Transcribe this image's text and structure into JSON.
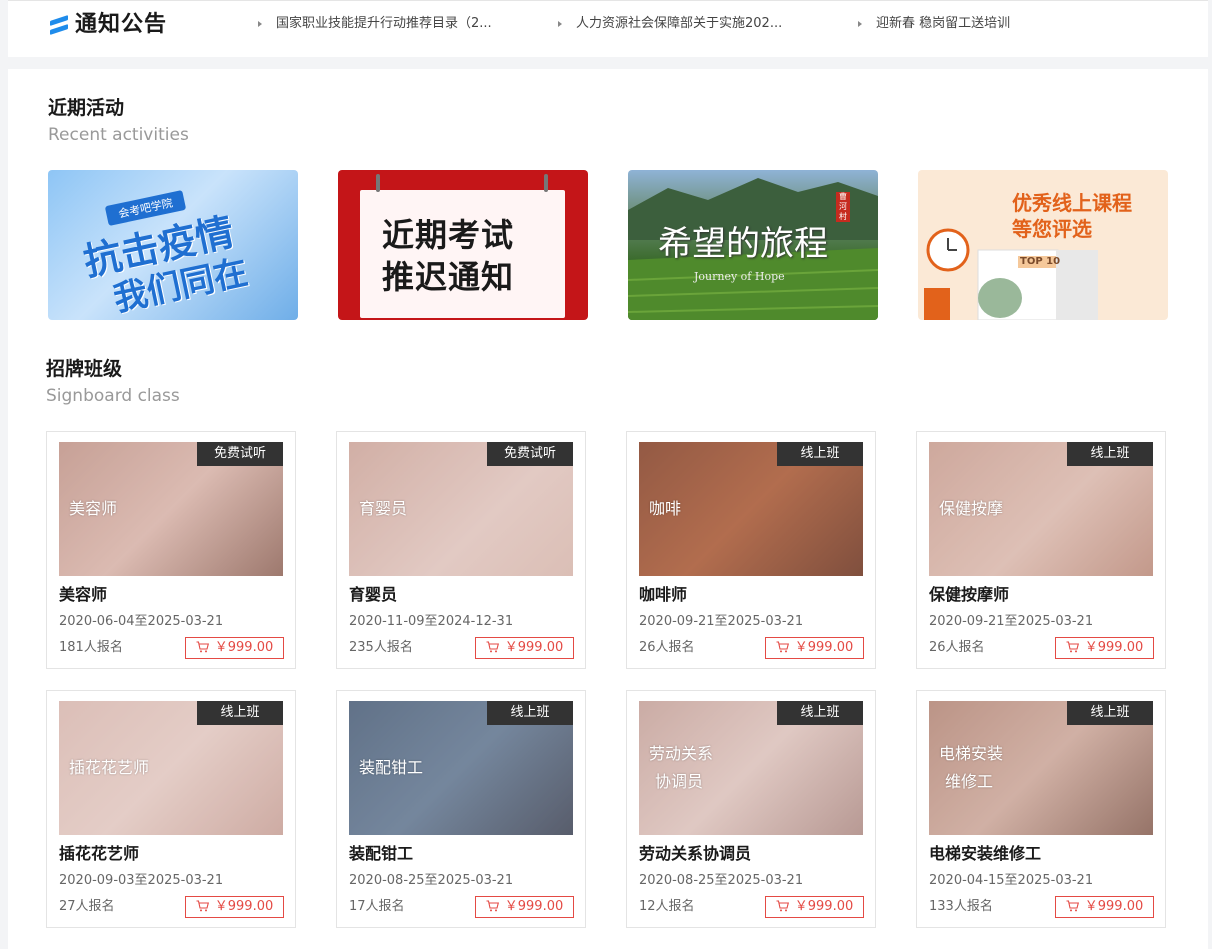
{
  "notice": {
    "title": "通知公告",
    "items": [
      "国家职业技能提升行动推荐目录（2...",
      "人力资源社会保障部关于实施202...",
      "迎新春 稳岗留工送培训"
    ]
  },
  "activities": {
    "title": "近期活动",
    "subtitle": "Recent activities",
    "banners": [
      {
        "tag": "会考吧学院",
        "line1": "抗击疫情",
        "line2": "我们同在"
      },
      {
        "line1": "近期考试",
        "line2": "推迟通知"
      },
      {
        "line1": "希望的旅程",
        "sub": "Journey of Hope",
        "seal": "曹河村"
      },
      {
        "line1": "优秀线上课程",
        "line2": "等您评选",
        "tag": "TOP 10"
      }
    ]
  },
  "classes": {
    "title": "招牌班级",
    "subtitle": "Signboard class",
    "items": [
      {
        "badge": "免费试听",
        "overlay": "美容师",
        "name": "美容师",
        "date": "2020-06-04至2025-03-21",
        "count": "181人报名",
        "price": "￥999.00"
      },
      {
        "badge": "免费试听",
        "overlay": "育婴员",
        "name": "育婴员",
        "date": "2020-11-09至2024-12-31",
        "count": "235人报名",
        "price": "￥999.00"
      },
      {
        "badge": "线上班",
        "overlay": "咖啡",
        "name": "咖啡师",
        "date": "2020-09-21至2025-03-21",
        "count": "26人报名",
        "price": "￥999.00"
      },
      {
        "badge": "线上班",
        "overlay": "保健按摩",
        "name": "保健按摩师",
        "date": "2020-09-21至2025-03-21",
        "count": "26人报名",
        "price": "￥999.00"
      },
      {
        "badge": "线上班",
        "overlay": "插花花艺师",
        "name": "插花花艺师",
        "date": "2020-09-03至2025-03-21",
        "count": "27人报名",
        "price": "￥999.00"
      },
      {
        "badge": "线上班",
        "overlay": "装配钳工",
        "name": "装配钳工",
        "date": "2020-08-25至2025-03-21",
        "count": "17人报名",
        "price": "￥999.00"
      },
      {
        "badge": "线上班",
        "overlay": "劳动关系\n协调员",
        "name": "劳动关系协调员",
        "date": "2020-08-25至2025-03-21",
        "count": "12人报名",
        "price": "￥999.00"
      },
      {
        "badge": "线上班",
        "overlay": "电梯安装\n维修工",
        "name": "电梯安装维修工",
        "date": "2020-04-15至2025-03-21",
        "count": "133人报名",
        "price": "￥999.00"
      }
    ]
  }
}
